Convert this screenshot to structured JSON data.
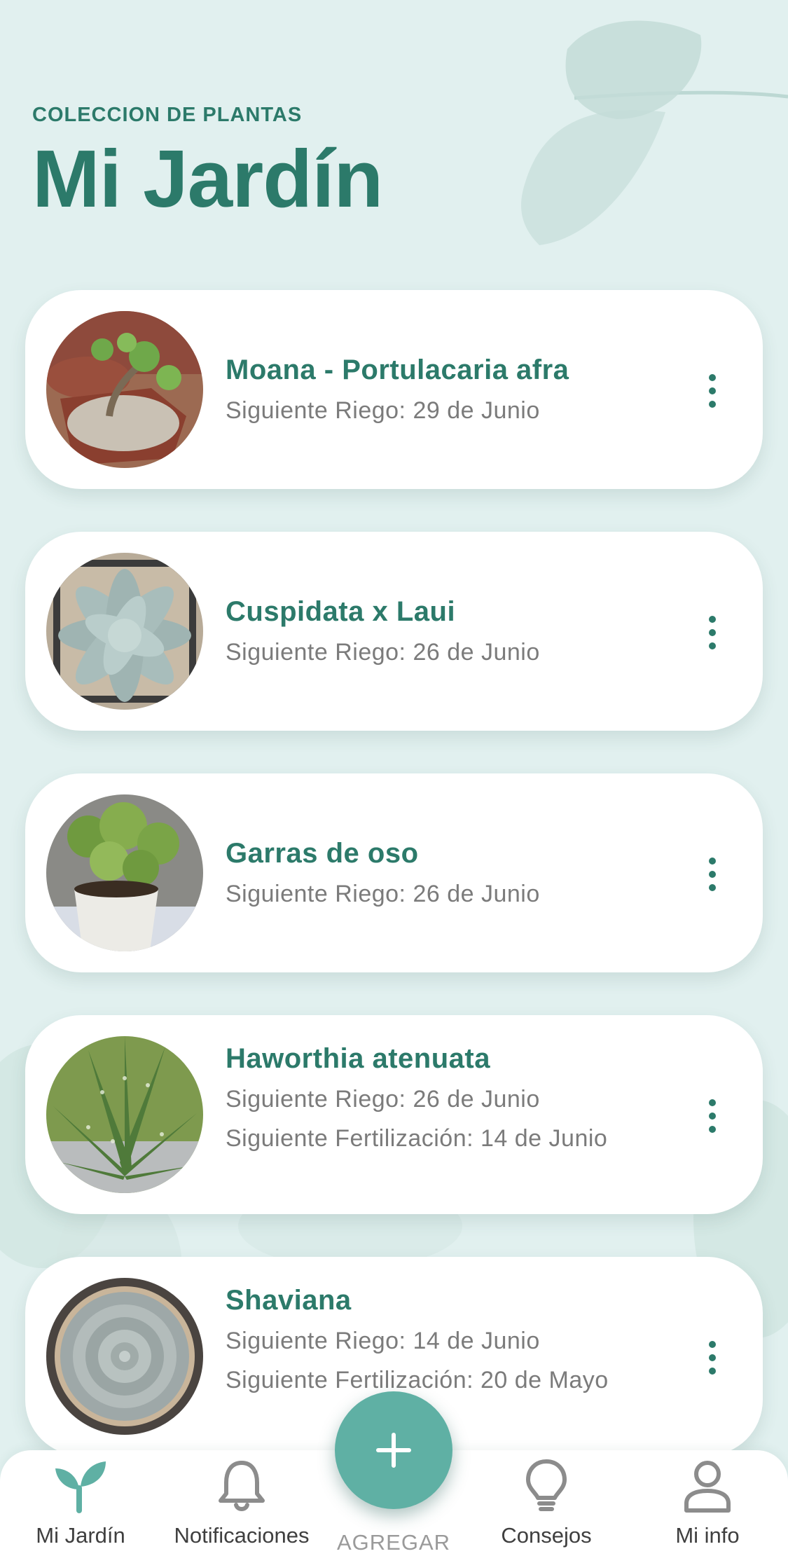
{
  "header": {
    "subtitle": "COLECCION DE PLANTAS",
    "title": "Mi Jardín"
  },
  "plants": [
    {
      "name": "Moana - Portulacaria afra",
      "lines": [
        "Siguiente Riego: 29 de Junio"
      ],
      "image": "jade-bonsai-photo"
    },
    {
      "name": "Cuspidata x Laui",
      "lines": [
        "Siguiente Riego: 26 de Junio"
      ],
      "image": "echeveria-photo"
    },
    {
      "name": "Garras de oso",
      "lines": [
        "Siguiente Riego: 26 de Junio"
      ],
      "image": "bear-paw-succulent-photo"
    },
    {
      "name": "Haworthia atenuata",
      "lines": [
        "Siguiente Riego: 26 de Junio",
        "Siguiente Fertilización: 14 de Junio"
      ],
      "image": "haworthia-photo"
    },
    {
      "name": "Shaviana",
      "lines": [
        "Siguiente Riego: 14 de Junio",
        "Siguiente Fertilización: 20 de Mayo"
      ],
      "image": "shaviana-rosette-photo"
    }
  ],
  "fab": {
    "label": "AGREGAR",
    "icon": "plus-icon"
  },
  "tabs": [
    {
      "label": "Mi Jardín",
      "icon": "sprout-icon",
      "active": true
    },
    {
      "label": "Notificaciones",
      "icon": "bell-icon",
      "active": false
    },
    {
      "label": "Consejos",
      "icon": "lightbulb-icon",
      "active": false
    },
    {
      "label": "Mi info",
      "icon": "user-icon",
      "active": false
    }
  ],
  "colors": {
    "background": "#e1f0ef",
    "accent": "#2c7a6a",
    "fab": "#5fb0a4",
    "active_tab_icon": "#5fb0a4",
    "inactive_tab_icon": "#8c8c8c"
  }
}
